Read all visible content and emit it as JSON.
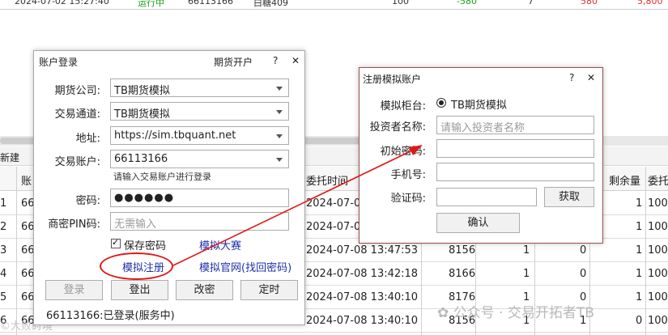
{
  "background": {
    "top_row": [
      "2024-07-02 15:27:40",
      "运行中",
      "66113166",
      "白糖409",
      "100",
      "-580",
      "7",
      "580",
      "5,800"
    ],
    "toolbar_new": "新建",
    "headers": [
      "账",
      "委托时间",
      "剩余量",
      "委托"
    ],
    "rows": [
      {
        "idx": "1",
        "acct": "66",
        "time": "2024-07-08",
        "price": "",
        "a": "",
        "b": "",
        "rem": "1",
        "tail": "100"
      },
      {
        "idx": "2",
        "acct": "66",
        "time": "2024-07-08",
        "price": "",
        "a": "",
        "b": "",
        "rem": "1",
        "tail": "100"
      },
      {
        "idx": "3",
        "acct": "66",
        "time": "2024-07-08 13:47:53",
        "price": "8156",
        "a": "1",
        "b": "0",
        "rem": "1",
        "tail": "100"
      },
      {
        "idx": "4",
        "acct": "66",
        "time": "2024-07-08 13:42:18",
        "price": "8166",
        "a": "1",
        "b": "0",
        "rem": "1",
        "tail": "100"
      },
      {
        "idx": "5",
        "acct": "66",
        "time": "2024-07-08 13:40:10",
        "price": "8176",
        "a": "1",
        "b": "0",
        "rem": "1",
        "tail": "100"
      },
      {
        "idx": "6",
        "acct": "66",
        "time": "2024-07-08 13:40:10",
        "price": "8156",
        "a": "1",
        "b": "1",
        "rem": "0",
        "tail": "100"
      }
    ]
  },
  "login": {
    "title": "账户登录",
    "open_account": "期货开户",
    "help": "?",
    "close": "✕",
    "company_label": "期货公司:",
    "company_value": "TB期货模拟",
    "channel_label": "交易通道:",
    "channel_value": "TB期货模拟",
    "address_label": "地址:",
    "address_value": "https://sim.tbquant.net",
    "account_label": "交易账户:",
    "account_value": "66113166",
    "account_hint": "请输入交易账户进行登录",
    "password_label": "密码:",
    "password_value": "●●●●●●",
    "pin_label": "商密PIN码:",
    "pin_placeholder": "无需输入",
    "save_password": "保存密码",
    "contest_link": "模拟大赛",
    "register_link": "模拟注册",
    "website_link": "模拟官网(找回密码)",
    "btn_login": "登录",
    "btn_logout": "登出",
    "btn_change_password": "改密",
    "btn_timed": "定时",
    "status": "66113166:已登录(服务中)"
  },
  "register": {
    "title": "注册模拟账户",
    "help": "?",
    "close": "✕",
    "counter_label": "模拟柜台:",
    "counter_value": "TB期货模拟",
    "investor_label": "投资者名称:",
    "investor_placeholder": "请输入投资者名称",
    "init_password_label": "初始密码:",
    "phone_label": "手机号:",
    "code_label": "验证码:",
    "btn_get": "获取",
    "btn_confirm": "确认"
  },
  "watermark": "公众号 · 交易开拓者TB",
  "watermark_left": "©大败莳境",
  "colors": {
    "accent_red": "#e01818",
    "link_blue": "#1f2fa8",
    "loss_green": "#18a018",
    "profit_red": "#e03030"
  }
}
